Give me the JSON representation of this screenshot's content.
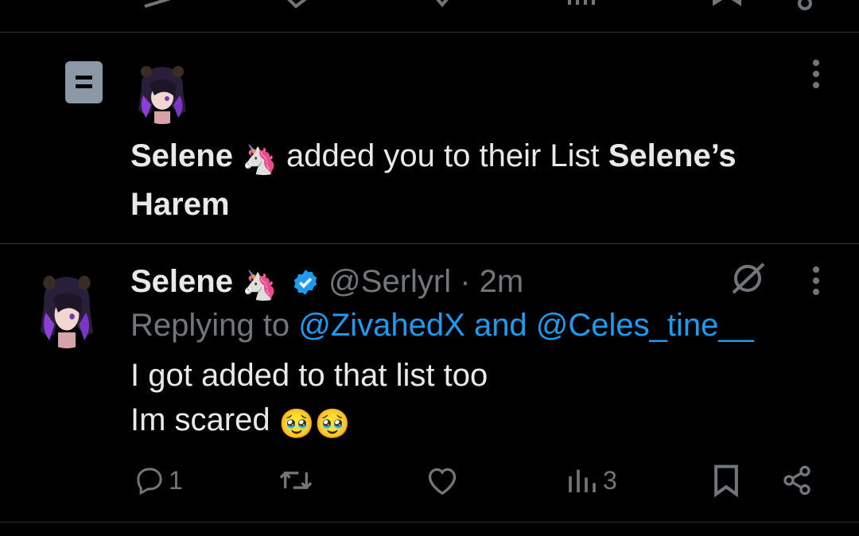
{
  "notification": {
    "actor_name": "Selene",
    "actor_emoji": "🦄",
    "action_text": " added you to their List ",
    "list_name": "Selene’s Harem"
  },
  "tweet": {
    "author_name": "Selene",
    "author_emoji": "🦄",
    "handle": "@Serlyrl",
    "separator": " · ",
    "time": "2m",
    "replying_prefix": "Replying to ",
    "reply_user_1": "@ZivahedX",
    "reply_join": " and ",
    "reply_user_2": "@Celes_tine__",
    "body_line_1": "I got added to that list too",
    "body_line_2": "Im scared ",
    "body_emojis": "🥹🥹",
    "reply_count": "1",
    "view_count": "3"
  },
  "icons": {
    "list": "list-icon",
    "more": "more-icon",
    "verified": "verified-badge-icon",
    "grok": "grok-icon",
    "reply": "reply-icon",
    "retweet": "retweet-icon",
    "like": "like-icon",
    "views": "views-icon",
    "bookmark": "bookmark-icon",
    "share": "share-icon"
  },
  "colors": {
    "background": "#000000",
    "text": "#e7e9ea",
    "muted": "#71767b",
    "link": "#1d9bf0",
    "verified": "#1d9bf0",
    "list_icon_bg": "#8b98a5"
  }
}
